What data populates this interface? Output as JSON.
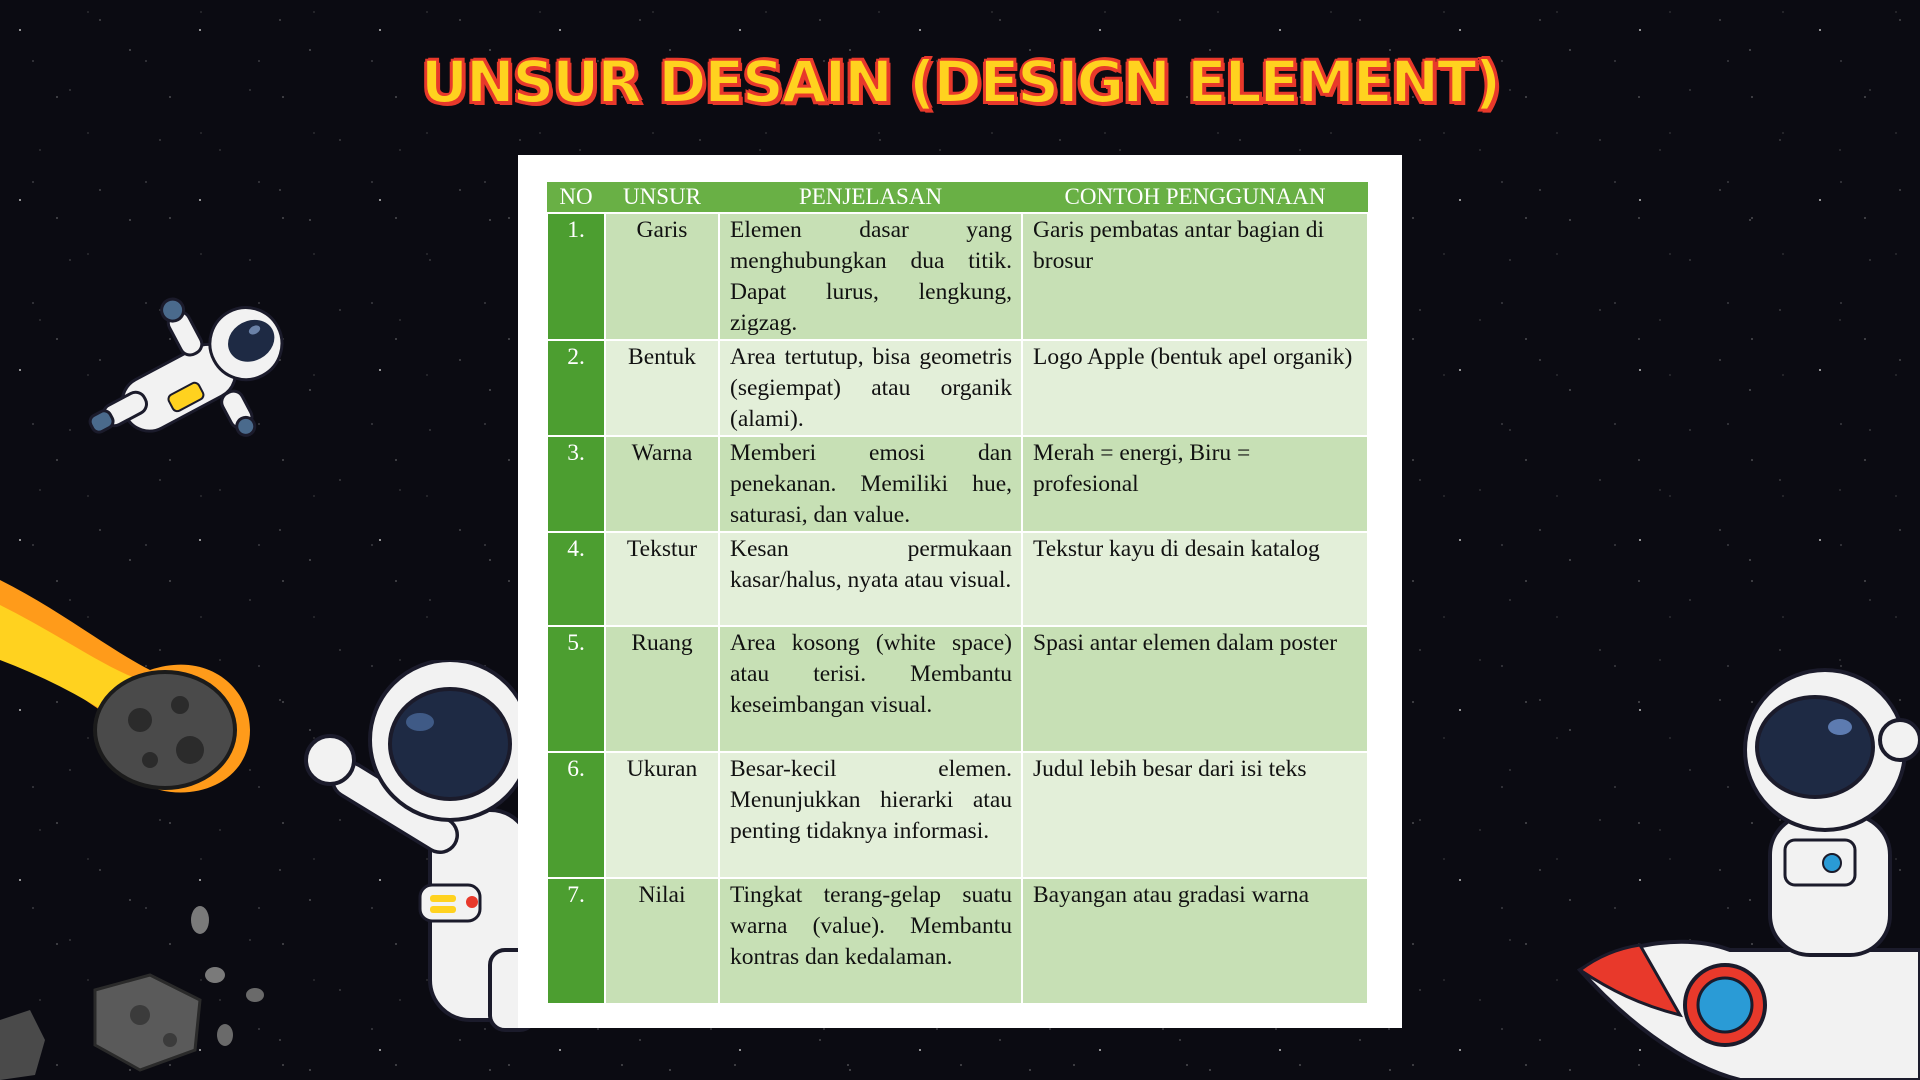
{
  "title": "UNSUR DESAIN (DESIGN ELEMENT)",
  "table": {
    "headers": [
      "NO",
      "UNSUR",
      "PENJELASAN",
      "CONTOH PENGGUNAAN"
    ],
    "rows": [
      {
        "no": "1.",
        "unsur": "Garis",
        "penjelasan": "Elemen dasar yang menghubungkan dua titik. Dapat lurus, lengkung, zigzag.",
        "contoh": "Garis pembatas antar bagian di brosur"
      },
      {
        "no": "2.",
        "unsur": "Bentuk",
        "penjelasan": "Area tertutup, bisa geometris (segiempat) atau organik (alami).",
        "contoh": "Logo Apple (bentuk apel organik)"
      },
      {
        "no": "3.",
        "unsur": "Warna",
        "penjelasan": "Memberi emosi dan penekanan. Memiliki hue, saturasi, dan value.",
        "contoh": "Merah = energi, Biru = profesional"
      },
      {
        "no": "4.",
        "unsur": "Tekstur",
        "penjelasan": "Kesan permukaan kasar/halus, nyata atau visual.",
        "contoh": "Tekstur kayu di desain katalog"
      },
      {
        "no": "5.",
        "unsur": "Ruang",
        "penjelasan": "Area kosong (white space) atau terisi. Membantu keseimbangan visual.",
        "contoh": "Spasi antar elemen dalam poster"
      },
      {
        "no": "6.",
        "unsur": "Ukuran",
        "penjelasan": "Besar-kecil elemen. Menunjukkan hierarki atau penting tidaknya informasi.",
        "contoh": "Judul lebih besar dari isi teks"
      },
      {
        "no": "7.",
        "unsur": "Nilai",
        "penjelasan": "Tingkat terang-gelap suatu warna (value). Membantu kontras dan kedalaman.",
        "contoh": "Bayangan atau gradasi warna"
      }
    ]
  },
  "colors": {
    "title_fill": "#ffd21f",
    "title_outline": "#e8392b",
    "header_green": "#69b045",
    "number_column_green": "#4c9e30",
    "row_light_green": "#c7e0b5",
    "row_pale_green": "#e3efd9",
    "background": "#0b0b12"
  },
  "decorations": [
    "astronaut-floating-icon",
    "meteor-icon",
    "asteroid-icon",
    "astronaut-waving-icon",
    "astronaut-on-rocket-icon"
  ]
}
